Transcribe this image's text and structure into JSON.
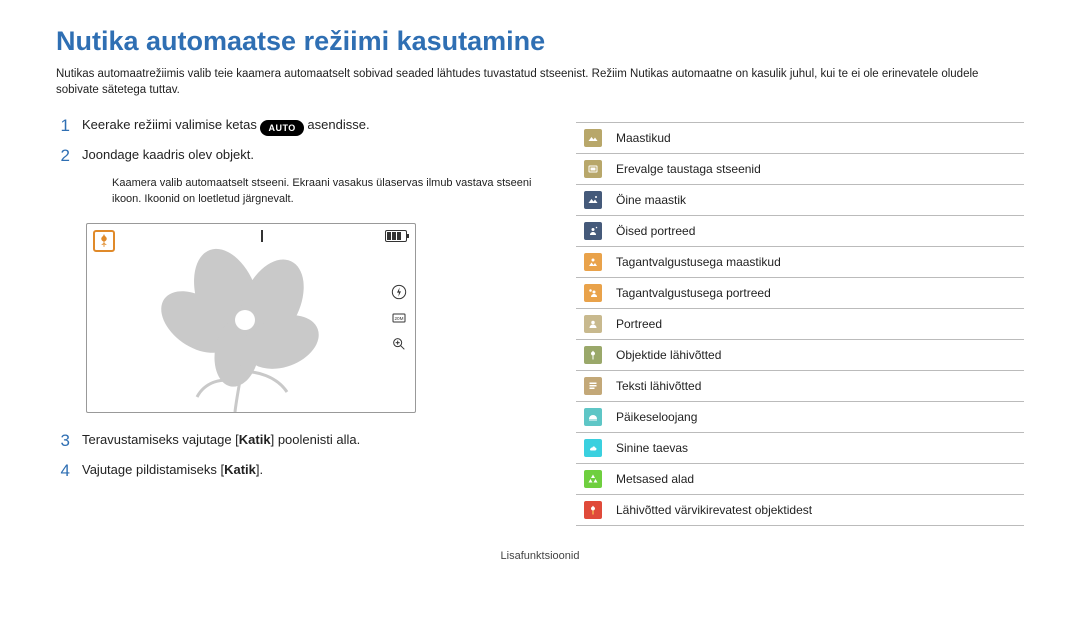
{
  "title": "Nutika automaatse režiimi kasutamine",
  "intro": "Nutikas automaatrežiimis valib teie kaamera automaatselt sobivad seaded lähtudes tuvastatud stseenist. Režiim Nutikas automaatne on kasulik juhul, kui te ei ole erinevatele oludele sobivate sätetega tuttav.",
  "steps": {
    "s1_pre": "Keerake režiimi valimise ketas ",
    "s1_pill": "AUTO",
    "s1_post": " asendisse.",
    "s2": "Joondage kaadris olev objekt.",
    "s2_note": "Kaamera valib automaatselt stseeni. Ekraani vasakus ülaservas ilmub vastava stseeni ikoon. Ikoonid on loetletud järgnevalt.",
    "s3_pre": "Teravustamiseks vajutage [",
    "s3_bold": "Katik",
    "s3_post": "] poolenisti alla.",
    "s4_pre": "Vajutage pildistamiseks [",
    "s4_bold": "Katik",
    "s4_post": "]."
  },
  "scenes": [
    {
      "label": "Maastikud",
      "cls": "c-olive"
    },
    {
      "label": "Erevalge taustaga stseenid",
      "cls": "c-brown"
    },
    {
      "label": "Öine maastik",
      "cls": "c-navy"
    },
    {
      "label": "Öised portreed",
      "cls": "c-navy2"
    },
    {
      "label": "Tagantvalgustusega maastikud",
      "cls": "c-orange"
    },
    {
      "label": "Tagantvalgustusega portreed",
      "cls": "c-orange2"
    },
    {
      "label": "Portreed",
      "cls": "c-tan"
    },
    {
      "label": "Objektide lähivõtted",
      "cls": "c-olive2"
    },
    {
      "label": "Teksti lähivõtted",
      "cls": "c-tan2"
    },
    {
      "label": "Päikeseloojang",
      "cls": "c-sunset"
    },
    {
      "label": "Sinine taevas",
      "cls": "c-cyan"
    },
    {
      "label": "Metsased alad",
      "cls": "c-green"
    },
    {
      "label": "Lähivõtted värvikirevatest objektidest",
      "cls": "c-red"
    }
  ],
  "footer": "Lisafunktsioonid"
}
